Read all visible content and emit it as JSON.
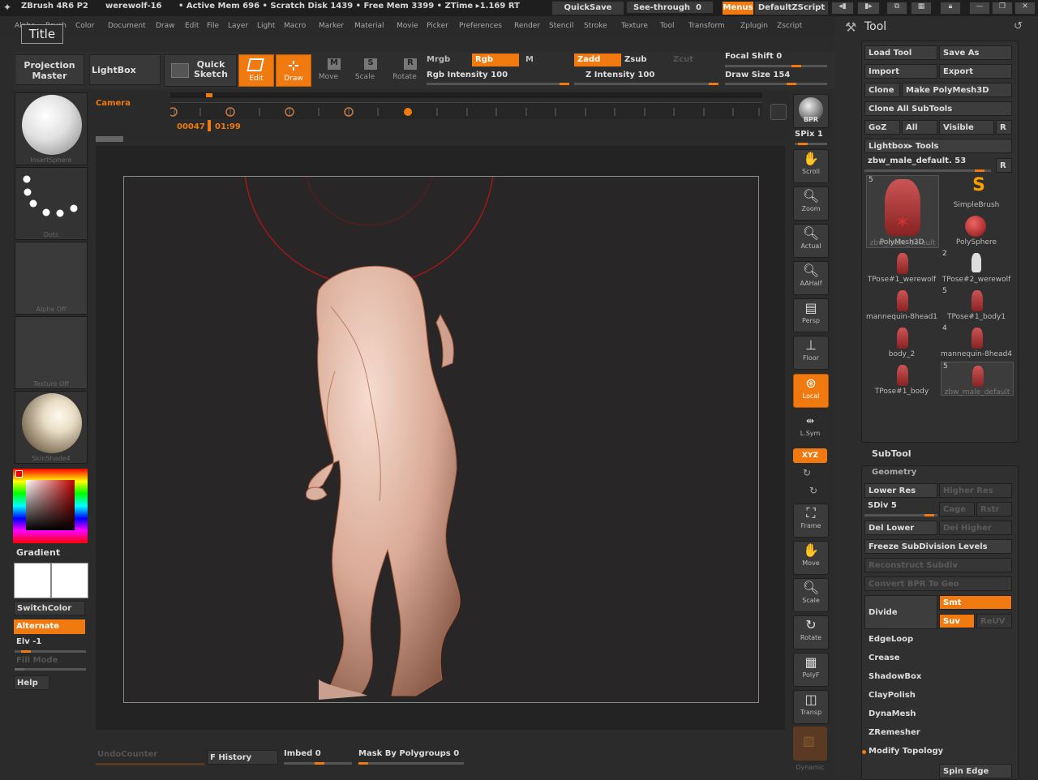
{
  "topbar": {
    "app_info": "ZBrush 4R6 P2",
    "document_name": "werewolf-16",
    "stats": "• Active Mem 696 • Scratch Disk 1439 • Free Mem 3399 • ZTime ▸1.169 RT",
    "quicksave": "QuickSave",
    "see_through_label": "See-through",
    "see_through_value": "0",
    "menus": "Menus",
    "default_zscript": "DefaultZScript"
  },
  "menu": {
    "items": [
      "Alpha",
      "Brush",
      "Color",
      "Document",
      "Draw",
      "Edit",
      "File",
      "Layer",
      "Light",
      "Macro",
      "Marker",
      "Material",
      "Movie",
      "Picker",
      "Preferences",
      "Render",
      "Stencil",
      "Stroke",
      "Texture",
      "Tool",
      "Transform",
      "Zplugin",
      "Zscript"
    ],
    "title_button": "Title"
  },
  "toolbar": {
    "projection_master": "Projection Master",
    "lightbox": "LightBox",
    "quick_sketch": "Quick Sketch",
    "edit": "Edit",
    "draw": "Draw",
    "move": "Move",
    "scale": "Scale",
    "rotate": "Rotate",
    "mrgb": "Mrgb",
    "rgb": "Rgb",
    "m": "M",
    "rgb_intensity": "Rgb Intensity 100",
    "zadd": "Zadd",
    "zsub": "Zsub",
    "zcut": "Zcut",
    "z_intensity": "Z Intensity 100",
    "focal_shift": "Focal Shift 0",
    "draw_size": "Draw Size 154"
  },
  "timeline": {
    "camera": "Camera",
    "frame": "00047",
    "time": "01:99"
  },
  "leftshelf": {
    "insert_sphere": "InsertSphere",
    "dots": "Dots",
    "alpha_off": "Alpha Off",
    "texture_off": "Texture Off",
    "material": "SkinShade4",
    "gradient": "Gradient",
    "switchcolor": "SwitchColor",
    "alternate": "Alternate",
    "elv": "Elv -1",
    "fill_mode": "Fill Mode",
    "help": "Help"
  },
  "rightshelf": {
    "bpr": "BPR",
    "spix": "SPix 1",
    "scroll": "Scroll",
    "zoom": "Zoom",
    "actual": "Actual",
    "aahalf": "AAHalf",
    "persp": "Persp",
    "floor": "Floor",
    "local": "Local",
    "lsym": "L.Sym",
    "xyz": "XYZ",
    "frame": "Frame",
    "move": "Move",
    "scale": "Scale",
    "rotate": "Rotate",
    "polyf": "PolyF",
    "transp": "Transp",
    "dynamic": "Dynamic"
  },
  "bottom": {
    "undocounter": "UndoCounter",
    "history": "F History",
    "imbed": "Imbed 0",
    "mask_by_polygroups": "Mask By Polygroups 0"
  },
  "toolpanel": {
    "title": "Tool",
    "load_tool": "Load Tool",
    "save_as": "Save As",
    "import": "Import",
    "export": "Export",
    "clone": "Clone",
    "make_polymesh": "Make PolyMesh3D",
    "clone_all": "Clone All SubTools",
    "goz": "GoZ",
    "all": "All",
    "visible": "Visible",
    "r": "R",
    "lightbox_tools": "Lightbox▸ Tools",
    "current_tool": "zbw_male_default. 53",
    "tools": [
      {
        "name": "zbw_male_default",
        "badge": "5"
      },
      {
        "name": "SimpleBrush",
        "badge": ""
      },
      {
        "name": "PolyMesh3D",
        "badge": ""
      },
      {
        "name": "PolySphere",
        "badge": ""
      },
      {
        "name": "TPose#1_werewolf",
        "badge": ""
      },
      {
        "name": "TPose#2_werewolf",
        "badge": "2"
      },
      {
        "name": "mannequin-8head1",
        "badge": ""
      },
      {
        "name": "TPose#1_body1",
        "badge": "5"
      },
      {
        "name": "body_2",
        "badge": ""
      },
      {
        "name": "mannequin-8head4",
        "badge": "4"
      },
      {
        "name": "TPose#1_body",
        "badge": ""
      },
      {
        "name": "zbw_male_default",
        "badge": "5"
      }
    ],
    "subtool": "SubTool",
    "geometry": "Geometry",
    "lower_res": "Lower Res",
    "higher_res": "Higher Res",
    "sdiv": "SDiv 5",
    "cage": "Cage",
    "rstr": "Rstr",
    "del_lower": "Del Lower",
    "del_higher": "Del Higher",
    "freeze": "Freeze SubDivision Levels",
    "reconstruct": "Reconstruct Subdiv",
    "convert_bpr": "Convert BPR To Geo",
    "divide": "Divide",
    "smt": "Smt",
    "suv": "Suv",
    "reuv": "ReUV",
    "edgeloop": "EdgeLoop",
    "crease": "Crease",
    "shadowbox": "ShadowBox",
    "claypolish": "ClayPolish",
    "dynamesh": "DynaMesh",
    "zremesher": "ZRemesher",
    "modify_topology": "Modify Topology",
    "spin_edge": "Spin Edge"
  },
  "colors": {
    "accent": "#f07a10",
    "background": "#2b2b2b",
    "canvas": "#262626",
    "model": "#e8b9a8"
  }
}
